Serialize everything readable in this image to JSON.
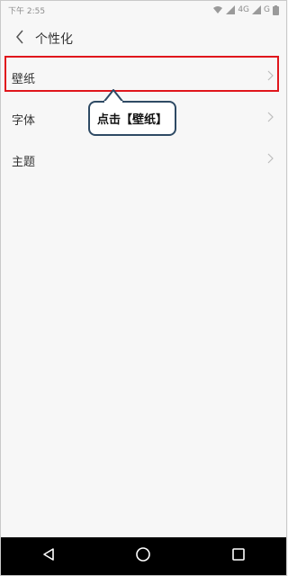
{
  "status_bar": {
    "time": "下午 2:55",
    "network": "4G",
    "carrier_short": "G",
    "icons": [
      "wifi-icon",
      "signal-icon",
      "battery-icon"
    ]
  },
  "app_bar": {
    "title": "个性化",
    "back_icon": "chevron-left-icon"
  },
  "list": {
    "items": [
      {
        "label": "壁纸"
      },
      {
        "label": "字体"
      },
      {
        "label": "主题"
      }
    ]
  },
  "annotation": {
    "callout_text": "点击【壁纸】",
    "highlight_color": "#e0161c",
    "callout_border_color": "#2e4a64"
  },
  "nav_bar": {
    "buttons": [
      "back-triangle-icon",
      "home-circle-icon",
      "recents-square-icon"
    ]
  }
}
